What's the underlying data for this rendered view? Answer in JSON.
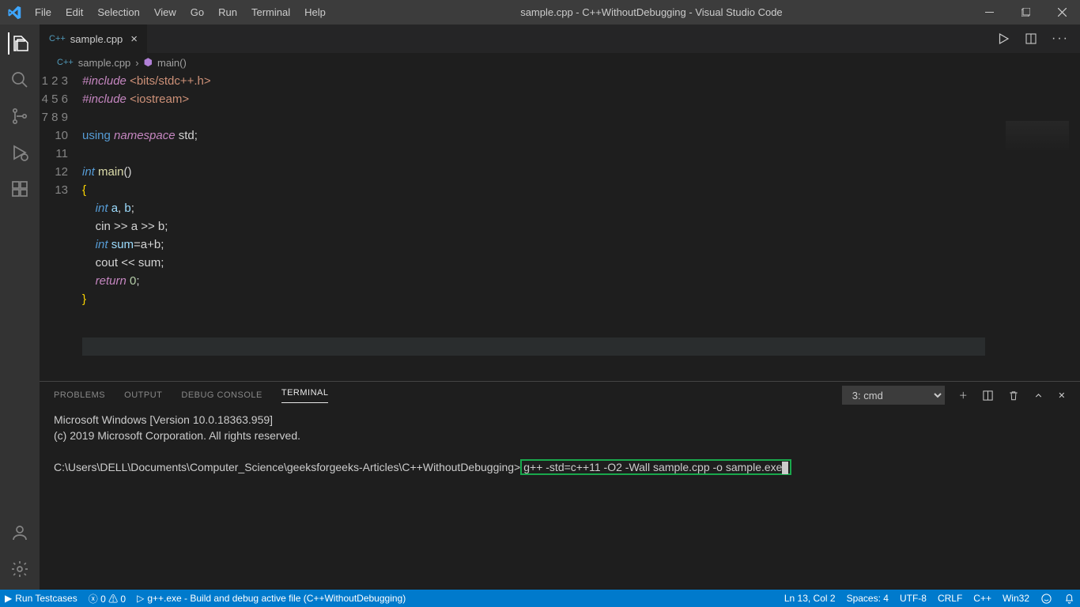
{
  "title": "sample.cpp - C++WithoutDebugging - Visual Studio Code",
  "menu": [
    "File",
    "Edit",
    "Selection",
    "View",
    "Go",
    "Run",
    "Terminal",
    "Help"
  ],
  "tab": {
    "filename": "sample.cpp",
    "lang": "C++"
  },
  "breadcrumb": {
    "file": "sample.cpp",
    "symbol": "main()"
  },
  "code_lines": 13,
  "panel": {
    "tabs": [
      "PROBLEMS",
      "OUTPUT",
      "DEBUG CONSOLE",
      "TERMINAL"
    ],
    "active": "TERMINAL",
    "shell": "3: cmd",
    "banner1": "Microsoft Windows [Version 10.0.18363.959]",
    "banner2": "(c) 2019 Microsoft Corporation. All rights reserved.",
    "prompt": "C:\\Users\\DELL\\Documents\\Computer_Science\\geeksforgeeks-Articles\\C++WithoutDebugging>",
    "cmd": "g++ -std=c++11 -O2 -Wall sample.cpp -o sample.exe"
  },
  "status": {
    "run": "Run Testcases",
    "errwarn": "0 ⚠ 0",
    "build": "g++.exe - Build and debug active file (C++WithoutDebugging)",
    "pos": "Ln 13, Col 2",
    "spaces": "Spaces: 4",
    "enc": "UTF-8",
    "eol": "CRLF",
    "lang": "C++",
    "platform": "Win32"
  }
}
